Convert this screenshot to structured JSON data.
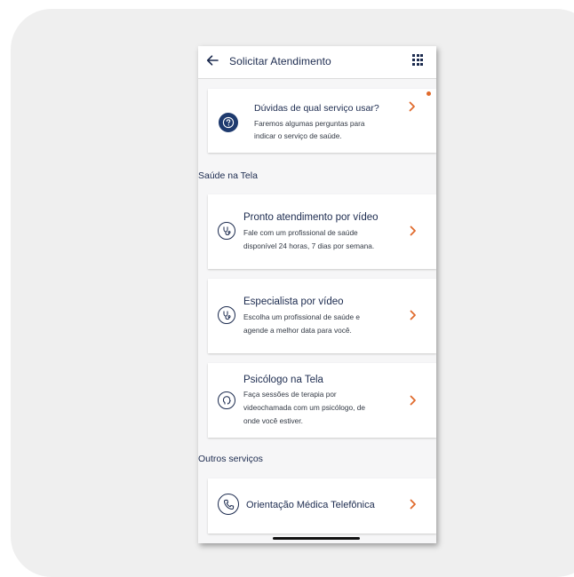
{
  "header": {
    "title": "Solicitar Atendimento"
  },
  "help_card": {
    "title": "Dúvidas de qual serviço usar?",
    "description_line1": "Faremos algumas perguntas para",
    "description_line2": "indicar o serviço de saúde."
  },
  "sections": {
    "saude": "Saúde na Tela",
    "outros": "Outros serviços"
  },
  "services": [
    {
      "title": "Pronto atendimento por vídeo",
      "line1": "Fale com um profissional de saúde",
      "line2": "disponível 24 horas, 7 dias por semana.",
      "icon": "stethoscope-icon"
    },
    {
      "title": "Especialista por vídeo",
      "line1": "Escolha um profissional de saúde e",
      "line2": "agende a melhor data para você.",
      "icon": "stethoscope-icon"
    },
    {
      "title": "Psicólogo na Tela",
      "line1": "Faça sessões de terapia por",
      "line2": "videochamada com um psicólogo, de",
      "line3": "onde você estiver.",
      "icon": "head-profile-icon"
    }
  ],
  "other_services": [
    {
      "title": "Orientação Médica Telefônica",
      "icon": "phone-icon"
    }
  ],
  "colors": {
    "primary_navy": "#1b2a4e",
    "accent_orange": "#e06a2c",
    "help_circle": "#1e3a6e"
  }
}
